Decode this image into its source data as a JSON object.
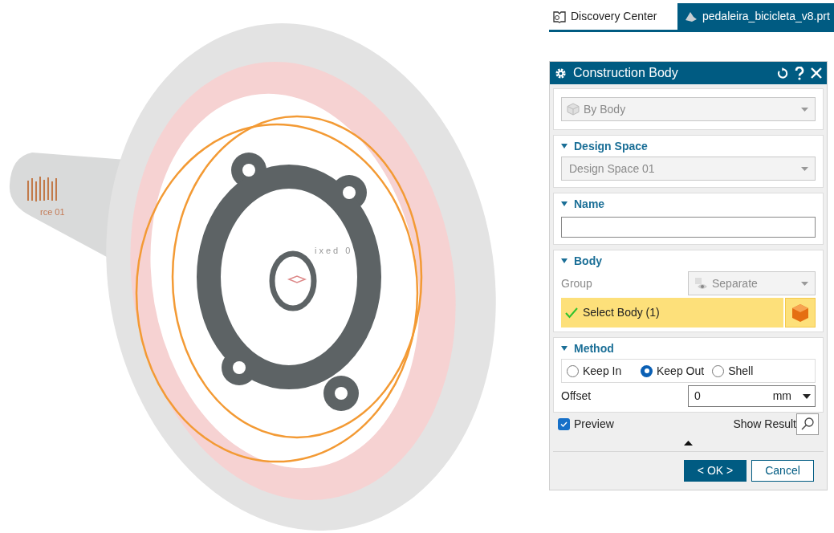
{
  "tabs": [
    {
      "label": "Discovery Center",
      "selected": false,
      "kind": "home"
    },
    {
      "label": "pedaleira_bicicleta_v8.prt",
      "selected": true,
      "kind": "part"
    }
  ],
  "viewport": {
    "labels": [
      "rce 01",
      "ixed 0"
    ]
  },
  "dialog": {
    "title": "Construction Body",
    "type_select": {
      "value": "By Body",
      "disabled": true
    },
    "design_space": {
      "header": "Design Space",
      "expanded": true,
      "select": {
        "value": "Design Space 01",
        "disabled": true
      }
    },
    "name": {
      "header": "Name",
      "expanded": true
    },
    "body": {
      "header": "Body",
      "expanded": true,
      "group_label": "Group",
      "group_disabled": true,
      "group_select": {
        "value": "Separate",
        "disabled": true
      },
      "select_body": {
        "label": "Select Body (1)",
        "active": true,
        "done": true
      }
    },
    "method": {
      "header": "Method",
      "expanded": true,
      "options": [
        {
          "label": "Keep In",
          "selected": false
        },
        {
          "label": "Keep Out",
          "selected": true
        },
        {
          "label": "Shell",
          "selected": false
        }
      ],
      "offset_label": "Offset",
      "offset_value": "0",
      "offset_unit": "mm"
    },
    "preview": {
      "label": "Preview",
      "checked": true
    },
    "show_result": "Show Result",
    "buttons": [
      {
        "label": "< OK >",
        "kind": "primary"
      },
      {
        "label": "Cancel",
        "kind": "secondary"
      }
    ]
  }
}
